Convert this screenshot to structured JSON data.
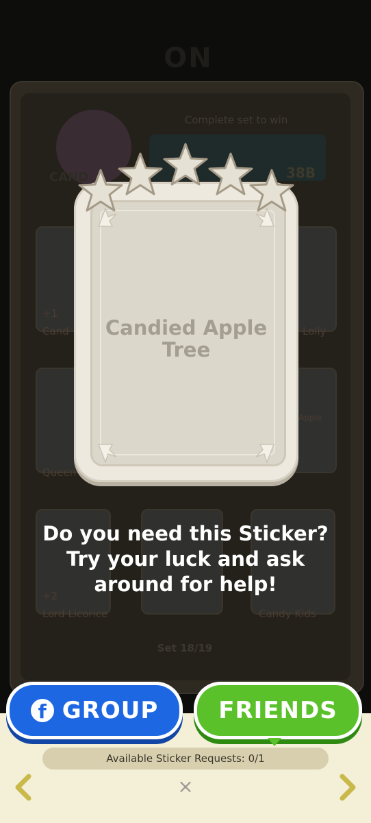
{
  "background": {
    "album_title": "ON",
    "album_subtitle": "Complete set to win",
    "reward_value": "38B",
    "album_badge": "CAND",
    "cards": [
      {
        "label": "Cand",
        "count": "+1"
      },
      {
        "label": "Lolly",
        "count": ""
      },
      {
        "label": "Queen",
        "count": ""
      },
      {
        "label": "Apple",
        "count": ""
      },
      {
        "label": "Lord Licorice",
        "count": "+2"
      },
      {
        "label": "Candy Kids",
        "count": ""
      }
    ],
    "set_label": "Set 18/19"
  },
  "sticker": {
    "name_line1": "Candied Apple",
    "name_line2": "Tree",
    "stars": 5
  },
  "message": {
    "line1": "Do you need this Sticker?",
    "line2": "Try your luck and ask",
    "line3": "around for help!"
  },
  "buttons": {
    "group_label": "GROUP",
    "friends_label": "FRIENDS"
  },
  "requests_text": "Available Sticker Requests: 0/1",
  "close_label": "×",
  "colors": {
    "group_blue": "#1e67e3",
    "friends_green": "#5bc12a",
    "panel_cream": "#f4efd7",
    "card_cream": "#ede9df"
  },
  "icons": {
    "group_icon": "facebook-icon",
    "prev": "chevron-left-icon",
    "next": "chevron-right-icon",
    "close": "close-icon"
  }
}
